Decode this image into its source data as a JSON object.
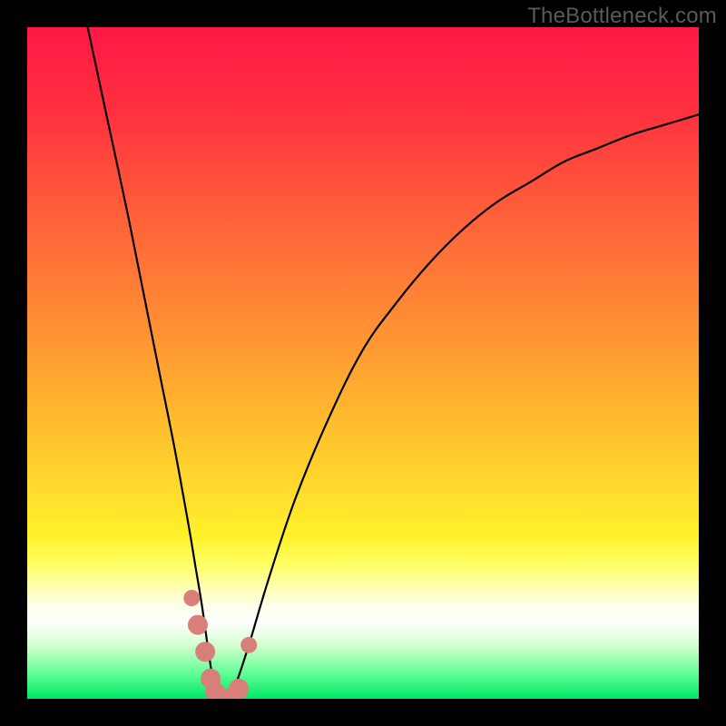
{
  "watermark": {
    "text": "TheBottleneck.com"
  },
  "colors": {
    "frame": "#000000",
    "curve_stroke": "#000000",
    "marker_fill": "#d97f7a",
    "gradient_stops": [
      {
        "offset": 0.0,
        "color": "#ff1846"
      },
      {
        "offset": 0.12,
        "color": "#ff2f3f"
      },
      {
        "offset": 0.28,
        "color": "#ff603a"
      },
      {
        "offset": 0.45,
        "color": "#ff9133"
      },
      {
        "offset": 0.62,
        "color": "#ffc62e"
      },
      {
        "offset": 0.76,
        "color": "#fff22c"
      },
      {
        "offset": 0.8,
        "color": "#ffff66"
      },
      {
        "offset": 0.83,
        "color": "#ffffa8"
      },
      {
        "offset": 0.86,
        "color": "#ffffe8"
      },
      {
        "offset": 0.885,
        "color": "#ffffff"
      },
      {
        "offset": 0.92,
        "color": "#d4ffcf"
      },
      {
        "offset": 0.96,
        "color": "#66ff99"
      },
      {
        "offset": 1.0,
        "color": "#00e765"
      }
    ]
  },
  "chart_data": {
    "type": "line",
    "title": "",
    "xlabel": "",
    "ylabel": "",
    "ylim": [
      0,
      100
    ],
    "xlim": [
      0,
      100
    ],
    "note": "V-shaped bottleneck curve; y≈0 near x≈28; rises steeply on both sides.",
    "series": [
      {
        "name": "bottleneck-curve",
        "x": [
          9,
          12,
          15,
          18,
          20,
          22,
          24,
          25,
          26,
          27,
          28,
          29,
          30,
          31,
          33,
          36,
          40,
          45,
          50,
          55,
          60,
          65,
          70,
          75,
          80,
          85,
          90,
          95,
          100
        ],
        "y": [
          100,
          86,
          72,
          57,
          47,
          37,
          26,
          20,
          14,
          7,
          1,
          0,
          0,
          2,
          8,
          18,
          30,
          42,
          52,
          59,
          65,
          70,
          74,
          77,
          80,
          82,
          84,
          85.5,
          87
        ]
      }
    ],
    "markers": {
      "name": "highlighted-points",
      "x": [
        24.5,
        25.4,
        26.5,
        27.3,
        28.0,
        29.0,
        30.0,
        31.0,
        31.5,
        33.0
      ],
      "y": [
        15,
        11,
        7,
        3,
        1,
        0,
        0,
        0.5,
        1.5,
        8
      ]
    }
  }
}
